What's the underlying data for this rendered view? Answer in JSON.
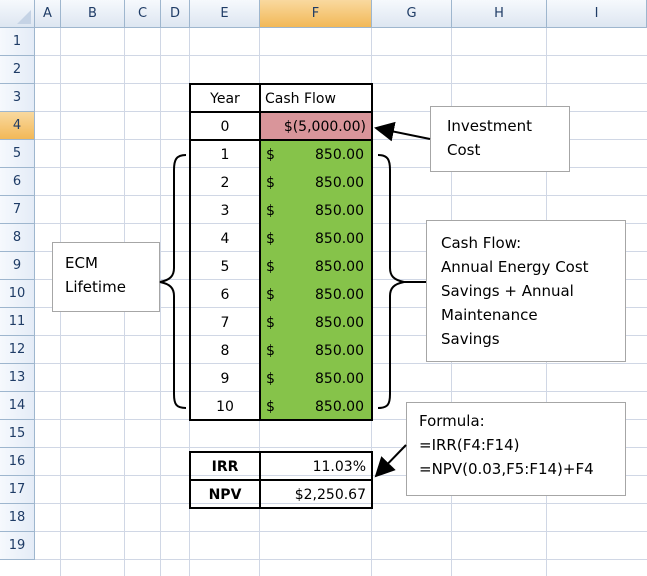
{
  "columns": [
    "A",
    "B",
    "C",
    "D",
    "E",
    "F",
    "G",
    "H",
    "I"
  ],
  "rows": [
    "1",
    "2",
    "3",
    "4",
    "5",
    "6",
    "7",
    "8",
    "9",
    "10",
    "11",
    "12",
    "13",
    "14",
    "15",
    "16",
    "17",
    "18",
    "19"
  ],
  "table": {
    "header_year": "Year",
    "header_cashflow": "Cash Flow",
    "initial": {
      "year": "0",
      "cashflow": "$(5,000.00)"
    },
    "flows": [
      {
        "year": "1",
        "currency": "$",
        "amount": "850.00"
      },
      {
        "year": "2",
        "currency": "$",
        "amount": "850.00"
      },
      {
        "year": "3",
        "currency": "$",
        "amount": "850.00"
      },
      {
        "year": "4",
        "currency": "$",
        "amount": "850.00"
      },
      {
        "year": "5",
        "currency": "$",
        "amount": "850.00"
      },
      {
        "year": "6",
        "currency": "$",
        "amount": "850.00"
      },
      {
        "year": "7",
        "currency": "$",
        "amount": "850.00"
      },
      {
        "year": "8",
        "currency": "$",
        "amount": "850.00"
      },
      {
        "year": "9",
        "currency": "$",
        "amount": "850.00"
      },
      {
        "year": "10",
        "currency": "$",
        "amount": "850.00"
      }
    ]
  },
  "summary": {
    "irr_label": "IRR",
    "irr_value": "11.03%",
    "npv_label": "NPV",
    "npv_value": "$2,250.67"
  },
  "callouts": {
    "investment": [
      "Investment",
      "Cost"
    ],
    "ecm": [
      "ECM",
      "Lifetime"
    ],
    "cashflow": [
      "Cash Flow:",
      "Annual Energy Cost",
      "Savings + Annual",
      "Maintenance",
      "Savings"
    ],
    "formula": [
      "Formula:",
      "=IRR(F4:F14)",
      "=NPV(0.03,F5:F14)+F4"
    ]
  },
  "colors": {
    "positive_fill": "#86c34a",
    "negative_fill": "#d9959a",
    "selected_header": "#f2b857",
    "gridline": "#d0d7e5"
  }
}
